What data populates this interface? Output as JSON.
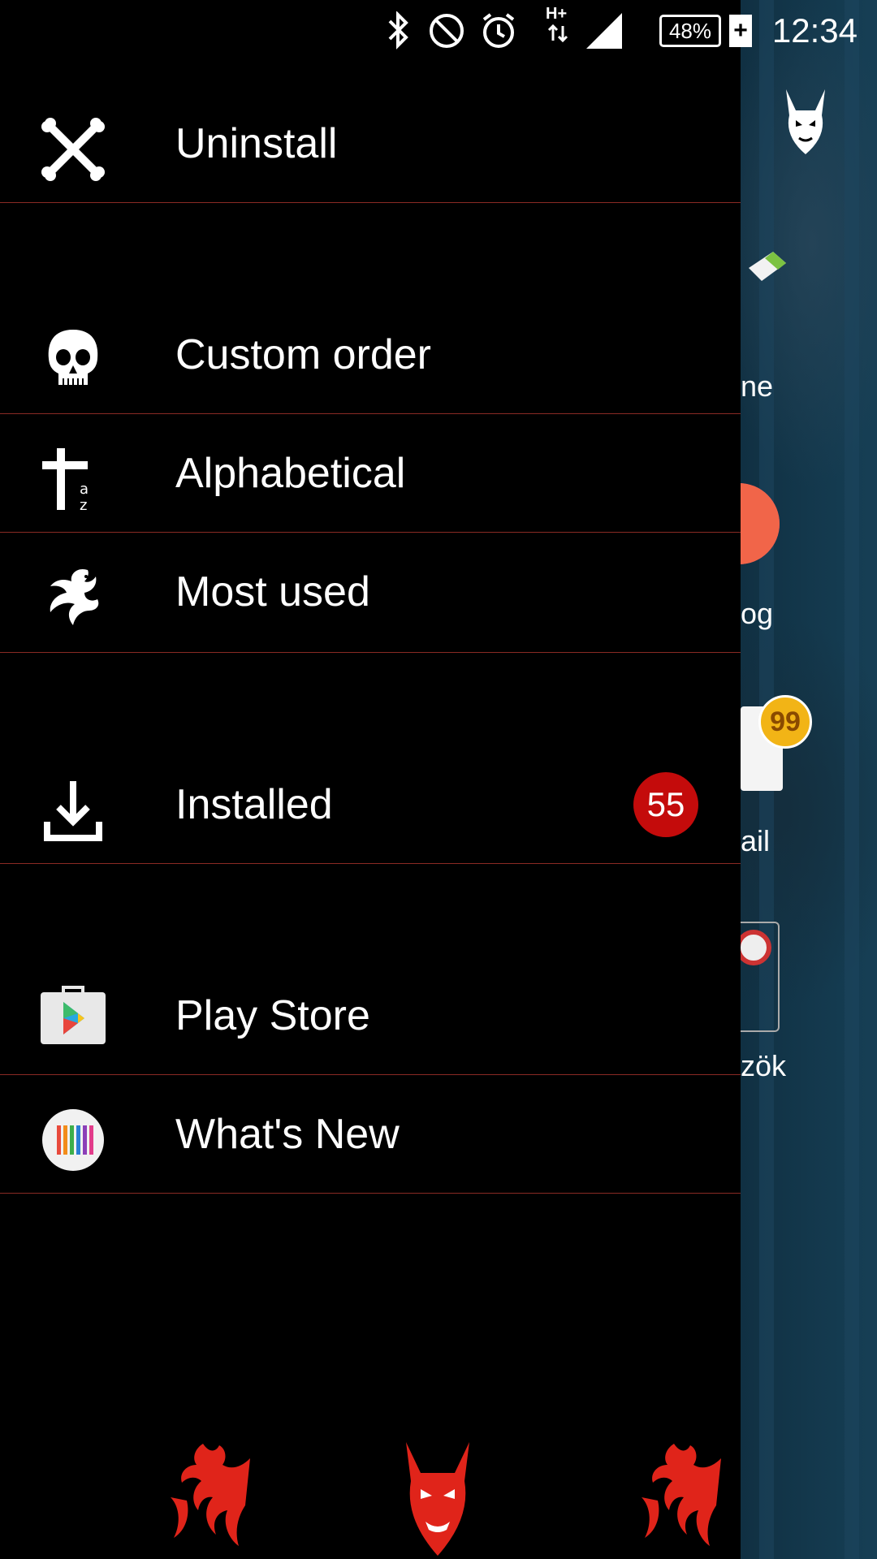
{
  "status_bar": {
    "battery": "48%",
    "time": "12:34",
    "network": "H+"
  },
  "drawer": {
    "top_item": {
      "label": "Uninstall",
      "icon": "crossbones-icon"
    },
    "sort_items": [
      {
        "label": "Custom order",
        "icon": "skull-icon"
      },
      {
        "label": "Alphabetical",
        "icon": "cross-az-icon"
      },
      {
        "label": "Most used",
        "icon": "dragon-icon"
      }
    ],
    "installed": {
      "label": "Installed",
      "icon": "download-icon",
      "count": "55"
    },
    "store_items": [
      {
        "label": "Play Store",
        "icon": "play-store-icon"
      },
      {
        "label": "What's New",
        "icon": "whats-new-icon"
      }
    ]
  },
  "background": {
    "peek_labels": [
      "ne",
      "og",
      "ail",
      "zök"
    ],
    "mail_badge": "99"
  },
  "colors": {
    "divider": "#8a2a24",
    "badge": "#c40b0b",
    "accent_red": "#e0241a"
  }
}
